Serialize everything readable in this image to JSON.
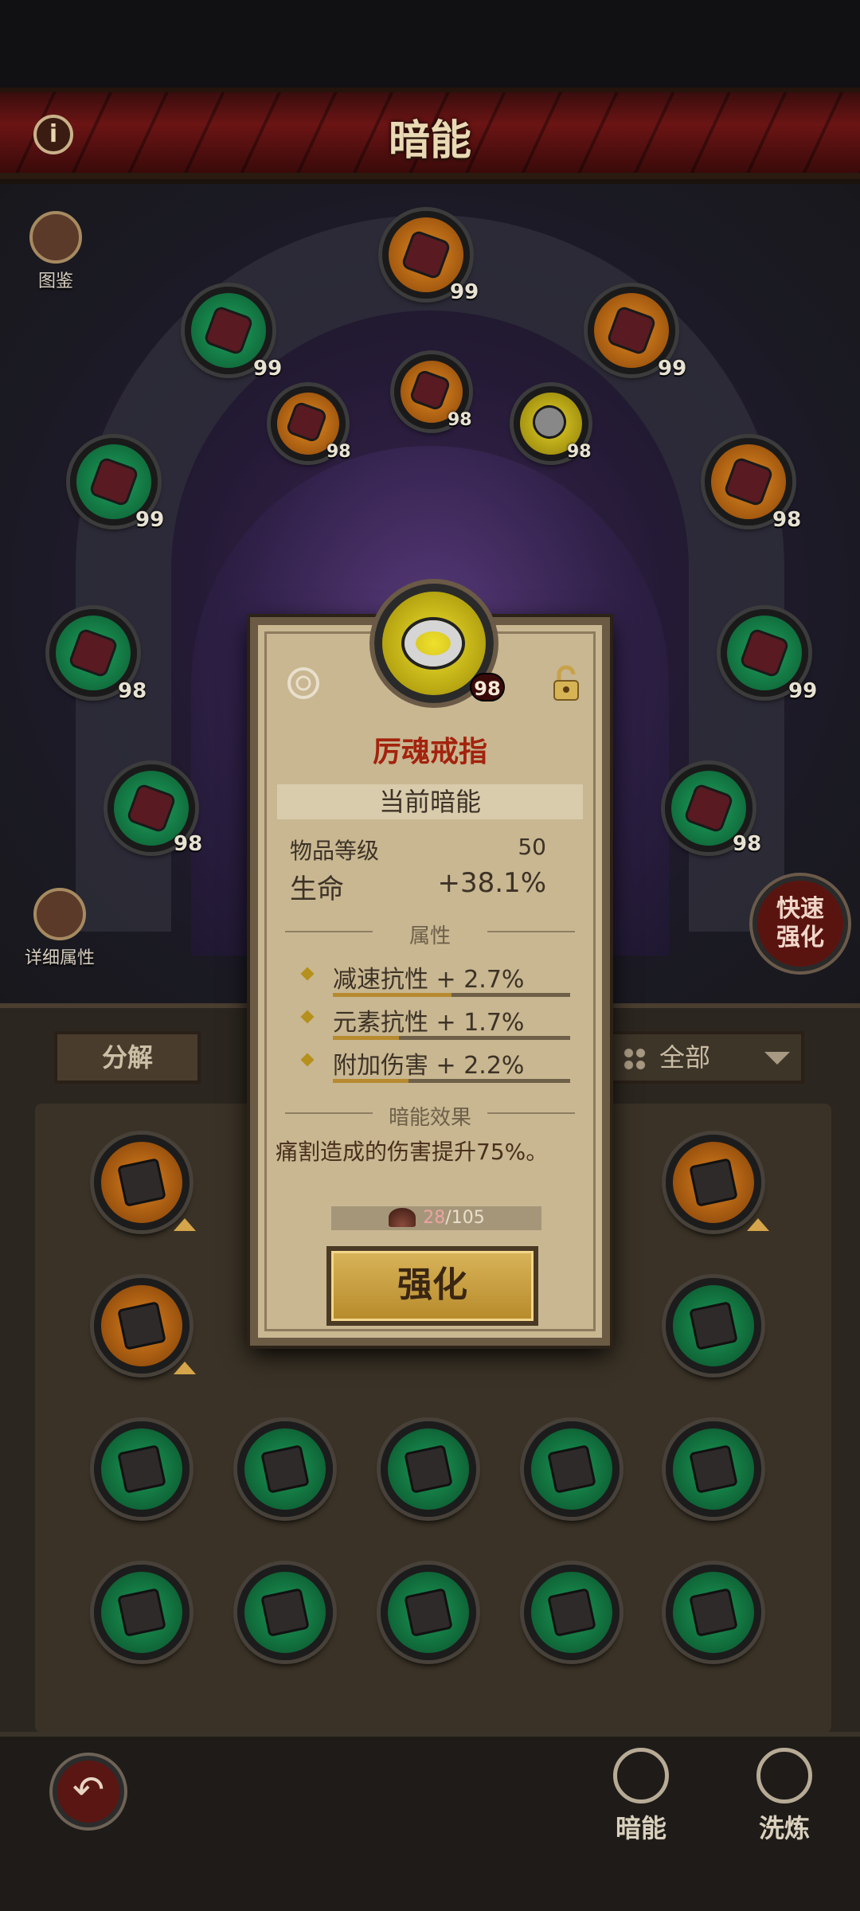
{
  "header": {
    "title": "暗能",
    "info_label": "i"
  },
  "side": {
    "codex_label": "图鉴",
    "details_label": "详细属性",
    "quick_label_1": "快速",
    "quick_label_2": "强化"
  },
  "slots": {
    "top": "99",
    "upper_left": "99",
    "upper_right": "99",
    "inner_left": "98",
    "inner_mid": "98",
    "inner_right": "98",
    "mid_left": "99",
    "mid_right": "98",
    "low_left": "98",
    "low_right": "99",
    "bottom_left": "98",
    "bottom_right": "98"
  },
  "panel": {
    "decompose_label": "分解",
    "filter_label": "全部"
  },
  "popup": {
    "level": "98",
    "name": "厉魂戒指",
    "section_current": "当前暗能",
    "item_level_label": "物品等级",
    "item_level_value": "50",
    "main_stat_label": "生命",
    "main_stat_value": "+38.1%",
    "attr_heading": "属性",
    "attributes": [
      {
        "text": "减速抗性 + 2.7%",
        "fill": 0.5
      },
      {
        "text": "元素抗性 + 1.7%",
        "fill": 0.28
      },
      {
        "text": "附加伤害 + 2.2%",
        "fill": 0.32
      }
    ],
    "effect_heading": "暗能效果",
    "effect_text": "痛割造成的伤害提升75%。",
    "cost_current": "28",
    "cost_total": "/105",
    "upgrade_label": "强化"
  },
  "nav": {
    "tab_dark": "暗能",
    "tab_refine": "洗炼",
    "back_symbol": "↶"
  },
  "colors": {
    "green": "#1c9a56",
    "orange": "#dc8220",
    "yellow": "#e4d02a",
    "header_red": "#6b1414",
    "parchment": "#c8b791"
  }
}
